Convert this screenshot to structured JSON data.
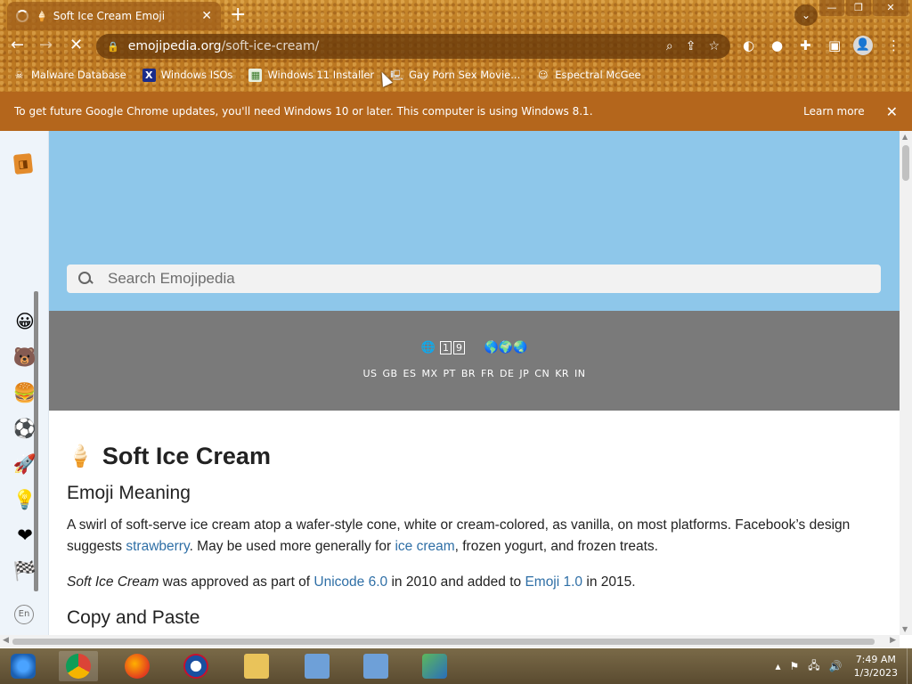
{
  "browser": {
    "tab_title": "Soft Ice Cream Emoji",
    "tab_close": "✕",
    "new_tab": "+",
    "url_domain": "emojipedia.org",
    "url_path": "/soft-ice-cream/",
    "bookmarks": [
      {
        "label": "Malware Database",
        "icon": "skull-icon"
      },
      {
        "label": "Windows ISOs",
        "icon": "x-logo-icon"
      },
      {
        "label": "Windows 11 Installer",
        "icon": "picture-icon"
      },
      {
        "label": "Gay Porn Sex Movie...",
        "icon": "computer-icon"
      },
      {
        "label": "Espectral McGee",
        "icon": "face-icon"
      }
    ]
  },
  "banner": {
    "message": "To get future Google Chrome updates, you'll need Windows 10 or later. This computer is using Windows 8.1.",
    "learn_more": "Learn more",
    "close": "✕"
  },
  "site": {
    "search_placeholder": "Search Emojipedia",
    "region_codes": "US GB ES MX PT BR FR DE JP CN KR IN",
    "region_numbers": [
      "1",
      "9"
    ],
    "categories": [
      "smileys-icon",
      "animals-icon",
      "food-icon",
      "activities-icon",
      "travel-icon",
      "objects-icon",
      "symbols-icon",
      "flags-icon"
    ],
    "lang": "En"
  },
  "article": {
    "emoji": "🍦",
    "title": "Soft Ice Cream",
    "meaning_heading": "Emoji Meaning",
    "meaning_p1_a": "A swirl of soft-serve ice cream atop a wafer-style cone, white or cream-colored, as vanilla, on most platforms. Facebook’s design suggests ",
    "meaning_link1": "strawberry",
    "meaning_p1_b": ". May be used more generally for ",
    "meaning_link2": "ice cream",
    "meaning_p1_c": ", frozen yogurt, and frozen treats.",
    "approved_em": "Soft Ice Cream",
    "approved_a": " was approved as part of ",
    "approved_link1": "Unicode 6.0",
    "approved_b": " in 2010 and added to ",
    "approved_link2": "Emoji 1.0",
    "approved_c": " in 2015.",
    "copy_heading": "Copy and Paste"
  },
  "taskbar": {
    "time": "7:49 AM",
    "date": "1/3/2023"
  }
}
